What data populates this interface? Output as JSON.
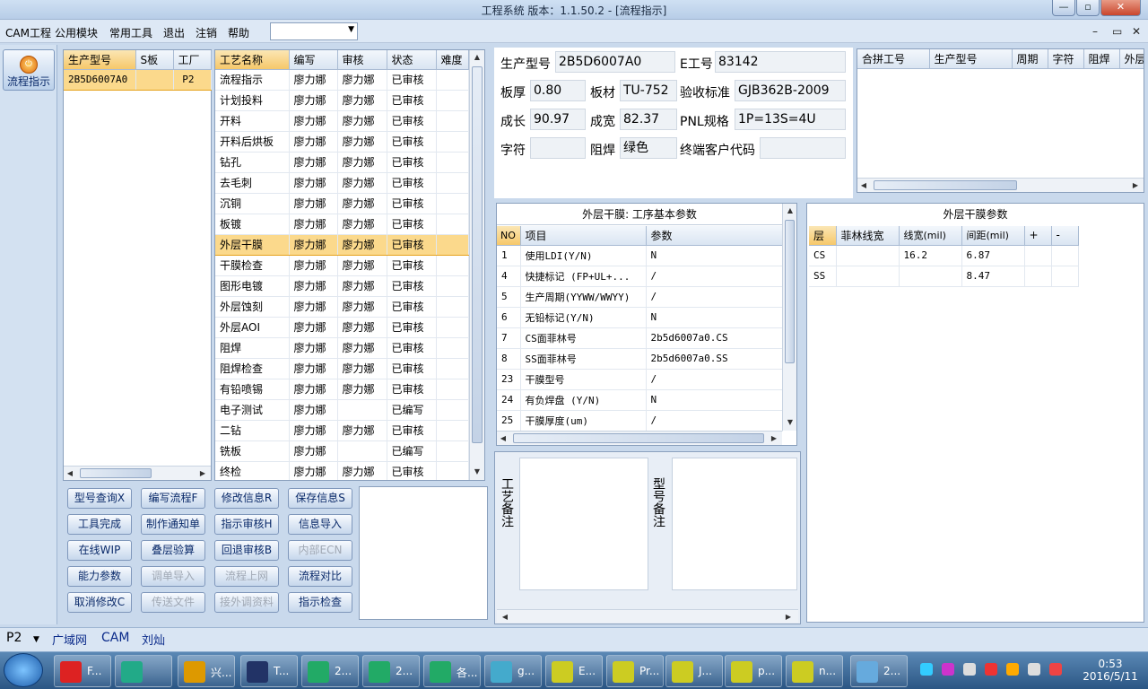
{
  "window": {
    "title": "工程系统  版本：1.1.50.2 - [流程指示]",
    "min": "—",
    "max": "▫",
    "close": "✕"
  },
  "menu": {
    "items": [
      "CAM工程",
      "公用模块",
      "常用工具",
      "退出",
      "注销",
      "帮助"
    ],
    "combo_value": "",
    "mdi_min": "–",
    "mdi_restore": "▭",
    "mdi_close": "✕"
  },
  "toolbar": {
    "flow_button": "流程指示"
  },
  "model_list": {
    "headers": [
      "生产型号",
      "S板",
      "工厂"
    ],
    "rows": [
      {
        "model": "2B5D6007A0",
        "s": "",
        "factory": "P2"
      }
    ]
  },
  "process_list": {
    "headers": [
      "工艺名称",
      "编写",
      "审核",
      "状态",
      "难度"
    ],
    "rows": [
      [
        "流程指示",
        "廖力娜",
        "廖力娜",
        "已审核",
        ""
      ],
      [
        "计划投料",
        "廖力娜",
        "廖力娜",
        "已审核",
        ""
      ],
      [
        "开料",
        "廖力娜",
        "廖力娜",
        "已审核",
        ""
      ],
      [
        "开料后烘板",
        "廖力娜",
        "廖力娜",
        "已审核",
        ""
      ],
      [
        "钻孔",
        "廖力娜",
        "廖力娜",
        "已审核",
        ""
      ],
      [
        "去毛刺",
        "廖力娜",
        "廖力娜",
        "已审核",
        ""
      ],
      [
        "沉铜",
        "廖力娜",
        "廖力娜",
        "已审核",
        ""
      ],
      [
        "板镀",
        "廖力娜",
        "廖力娜",
        "已审核",
        ""
      ],
      [
        "外层干膜",
        "廖力娜",
        "廖力娜",
        "已审核",
        ""
      ],
      [
        "干膜检查",
        "廖力娜",
        "廖力娜",
        "已审核",
        ""
      ],
      [
        "图形电镀",
        "廖力娜",
        "廖力娜",
        "已审核",
        ""
      ],
      [
        "外层蚀刻",
        "廖力娜",
        "廖力娜",
        "已审核",
        ""
      ],
      [
        "外层AOI",
        "廖力娜",
        "廖力娜",
        "已审核",
        ""
      ],
      [
        "阻焊",
        "廖力娜",
        "廖力娜",
        "已审核",
        ""
      ],
      [
        "阻焊检查",
        "廖力娜",
        "廖力娜",
        "已审核",
        ""
      ],
      [
        "有铅喷锡",
        "廖力娜",
        "廖力娜",
        "已审核",
        ""
      ],
      [
        "电子测试",
        "廖力娜",
        "",
        "已编写",
        ""
      ],
      [
        "二钻",
        "廖力娜",
        "廖力娜",
        "已审核",
        ""
      ],
      [
        "铣板",
        "廖力娜",
        "",
        "已编写",
        ""
      ],
      [
        "终检",
        "廖力娜",
        "廖力娜",
        "已审核",
        ""
      ]
    ],
    "selected_index": 8
  },
  "buttons": [
    [
      "型号查询X",
      "编写流程F",
      "修改信息R",
      "保存信息S"
    ],
    [
      "工具完成",
      "制作通知单",
      "指示审核H",
      "信息导入"
    ],
    [
      "在线WIP",
      "叠层验算",
      "回退审核B",
      "内部ECN"
    ],
    [
      "能力参数",
      "调单导入",
      "流程上网",
      "流程对比"
    ],
    [
      "取消修改C",
      "传送文件",
      "接外调资料",
      "指示检查"
    ]
  ],
  "disabled_buttons": [
    "内部ECN",
    "调单导入",
    "流程上网",
    "传送文件",
    "接外调资料"
  ],
  "info": {
    "model_label": "生产型号",
    "model": "2B5D6007A0",
    "e_label": "E工号",
    "e_no": "83142",
    "thick_label": "板厚",
    "thick": "0.80",
    "mat_label": "板材",
    "mat": "TU-752",
    "std_label": "验收标准",
    "std": "GJB362B-2009",
    "len_label": "成长",
    "len": "90.97",
    "wid_label": "成宽",
    "wid": "82.37",
    "pnl_label": "PNL规格",
    "pnl": "1P=13S=4U",
    "char_label": "字符",
    "char": "",
    "mask_label": "阻焊",
    "mask": "绿色",
    "cust_label": "终端客户代码",
    "cust": ""
  },
  "combo_list": {
    "headers": [
      "合拼工号",
      "生产型号",
      "周期",
      "字符",
      "阻焊",
      "外层"
    ]
  },
  "params": {
    "title": "外层干膜: 工序基本参数",
    "headers": [
      "NO",
      "项目",
      "参数"
    ],
    "rows": [
      [
        "1",
        "使用LDI(Y/N)",
        "N"
      ],
      [
        "4",
        "快捷标记 (FP+UL+...",
        "/"
      ],
      [
        "5",
        "生产周期(YYWW/WWYY)",
        "/"
      ],
      [
        "6",
        "无铅标记(Y/N)",
        "N"
      ],
      [
        "7",
        "CS面菲林号",
        "2b5d6007a0.CS"
      ],
      [
        "8",
        "SS面菲林号",
        "2b5d6007a0.SS"
      ],
      [
        "23",
        "干膜型号",
        "/"
      ],
      [
        "24",
        "有负焊盘 (Y/N)",
        "N"
      ],
      [
        "25",
        "干膜厚度(um)",
        "/"
      ]
    ]
  },
  "film": {
    "title": "外层干膜参数",
    "headers": [
      "层",
      "菲林线宽",
      "线宽(mil)",
      "间距(mil)",
      "+",
      "-"
    ],
    "rows": [
      [
        "CS",
        "",
        "16.2",
        "6.87",
        "",
        ""
      ],
      [
        "SS",
        "",
        "",
        "8.47",
        "",
        ""
      ]
    ]
  },
  "remarks": {
    "process": "工艺备注",
    "model": "型号备注"
  },
  "status": {
    "factory": "P2",
    "net": "广域网",
    "sys": "CAM",
    "user": "刘灿"
  },
  "taskbar": {
    "items": [
      "F...",
      "",
      "兴...",
      "T...",
      "2...",
      "2...",
      "各...",
      "g...",
      "E...",
      "Pr...",
      "J...",
      "p...",
      "n...",
      "2..."
    ],
    "time": "0:53",
    "date": "2016/5/11"
  }
}
